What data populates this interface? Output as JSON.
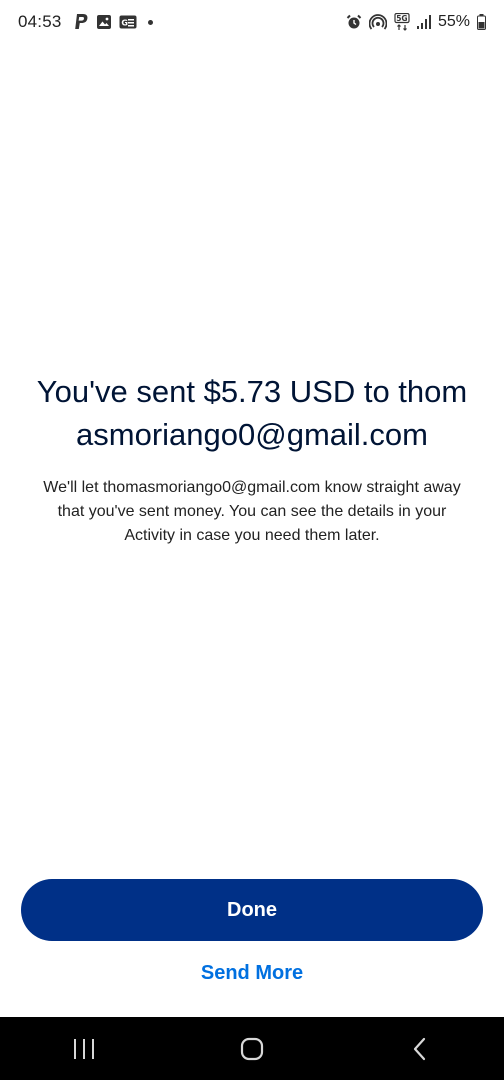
{
  "status_bar": {
    "time": "04:53",
    "battery": "55%",
    "left_icons": [
      "paypal-icon",
      "image-icon",
      "news-icon"
    ],
    "right_icons": [
      "alarm-icon",
      "hotspot-icon",
      "5g-icon",
      "signal-icon",
      "battery-icon"
    ]
  },
  "confirmation": {
    "headline": "You've sent $5.73 USD to thomasmoriango0@gmail.com",
    "message": "We'll let thomasmoriango0@gmail.com know straight away that you've sent money. You can see the details in your Activity in case you need them later."
  },
  "actions": {
    "done_label": "Done",
    "send_more_label": "Send More"
  },
  "colors": {
    "primary_button": "#003087",
    "link": "#0070e0",
    "headline": "#001435"
  },
  "nav_bar": {
    "icons": [
      "recent-apps-icon",
      "home-icon",
      "back-icon"
    ]
  }
}
